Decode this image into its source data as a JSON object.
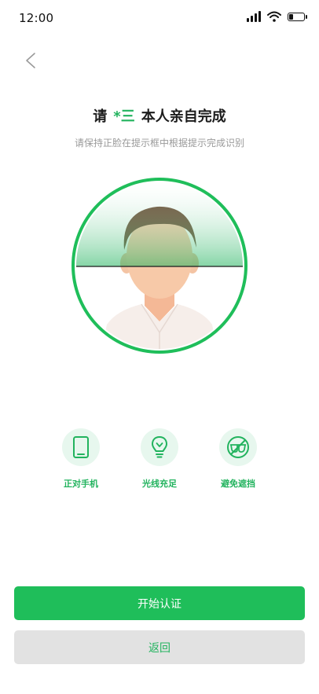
{
  "status_bar": {
    "time": "12:00"
  },
  "icons": {
    "back": "chevron-left-icon",
    "signal": "signal-icon",
    "wifi": "wifi-icon",
    "battery": "battery-icon",
    "phone": "phone-icon",
    "bulb": "lightbulb-icon",
    "no_glasses": "no-glasses-icon"
  },
  "header": {
    "title_prefix": "请",
    "title_name": "*三",
    "title_suffix": "本人亲自完成",
    "subtitle": "请保持正脸在提示框中根据提示完成识别"
  },
  "tips": [
    {
      "label": "正对手机"
    },
    {
      "label": "光线充足"
    },
    {
      "label": "避免遮挡"
    }
  ],
  "actions": {
    "start_label": "开始认证",
    "back_label": "返回"
  },
  "colors": {
    "accent": "#1fbe5a",
    "accent_text": "#22b35e",
    "tip_bg": "#e7f7ee",
    "secondary_bg": "#e2e2e2",
    "subtitle": "#9a9a9a"
  }
}
